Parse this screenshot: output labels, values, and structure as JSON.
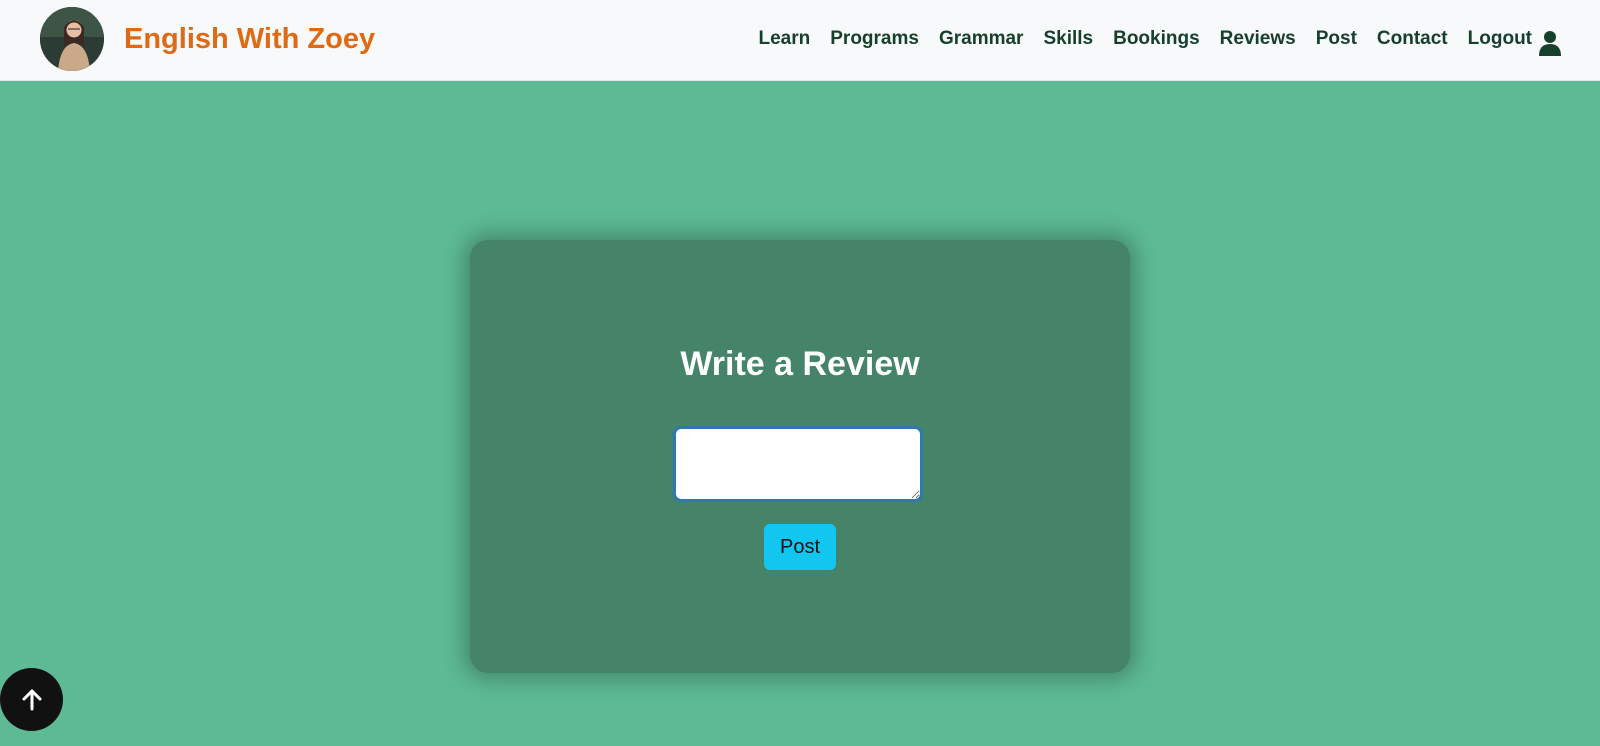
{
  "header": {
    "brand": "English With Zoey",
    "nav": [
      "Learn",
      "Programs",
      "Grammar",
      "Skills",
      "Bookings",
      "Reviews",
      "Post",
      "Contact",
      "Logout"
    ],
    "brand_color": "#e06a14",
    "nav_color": "#17402c"
  },
  "icons": {
    "avatar": "avatar",
    "user": "user-icon",
    "scroll_top": "arrow-up-icon"
  },
  "review_form": {
    "title": "Write a Review",
    "input_value": "",
    "post_label": "Post",
    "button_color": "#12c6ef"
  },
  "colors": {
    "page_background": "#5dba95",
    "card_background": "#46846a",
    "navbar_background": "#f7f9fa"
  }
}
